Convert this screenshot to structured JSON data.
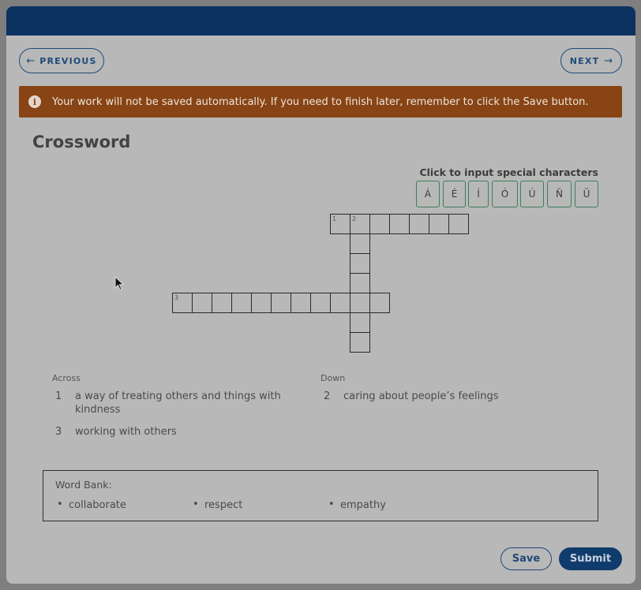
{
  "nav": {
    "previous_label": "PREVIOUS",
    "next_label": "NEXT"
  },
  "banner": {
    "icon": "info-icon",
    "text": "Your work will not be saved automatically. If you need to finish later, remember to click the Save button."
  },
  "title": "Crossword",
  "special_characters": {
    "label": "Click to input special characters",
    "chars": [
      "Á",
      "É",
      "Í",
      "Ó",
      "Ú",
      "Ñ",
      "Ü"
    ]
  },
  "grid_numbers": [
    "1",
    "2",
    "3"
  ],
  "clues": {
    "across_heading": "Across",
    "down_heading": "Down",
    "across": [
      {
        "number": "1",
        "text": "a way of treating others and things with kindness"
      },
      {
        "number": "3",
        "text": "working with others"
      }
    ],
    "down": [
      {
        "number": "2",
        "text": "caring about people’s feelings"
      }
    ]
  },
  "word_bank": {
    "label": "Word Bank:",
    "words": [
      "collaborate",
      "respect",
      "empathy"
    ]
  },
  "actions": {
    "save_label": "Save",
    "submit_label": "Submit"
  },
  "colors": {
    "header": "#0b3161",
    "banner": "#884414",
    "primary": "#103c6d",
    "special_char_border": "#3f7d5a"
  }
}
